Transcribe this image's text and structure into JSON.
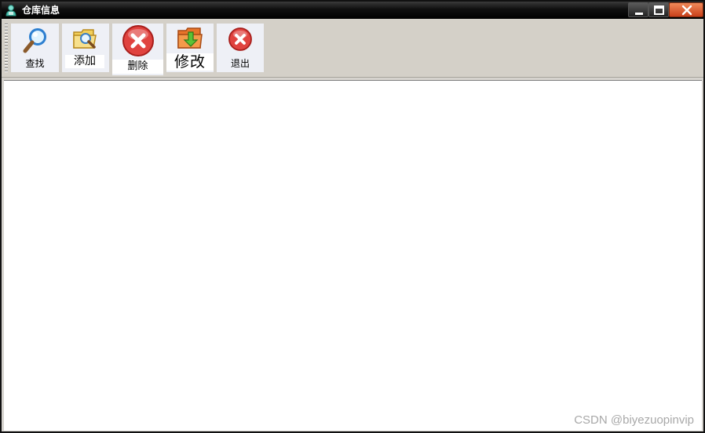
{
  "window": {
    "title": "仓库信息",
    "title_icon": "app-user-icon",
    "controls": {
      "minimize": "minimize-icon",
      "maximize": "maximize-icon",
      "close": "close-icon"
    }
  },
  "toolbar": {
    "buttons": [
      {
        "label": "查找",
        "icon": "magnifier-icon"
      },
      {
        "label": "添加",
        "icon": "folder-search-icon"
      },
      {
        "label": "删除",
        "icon": "red-x-circle-icon"
      },
      {
        "label": "修改",
        "icon": "folder-arrow-icon"
      },
      {
        "label": "退出",
        "icon": "red-x-circle-icon"
      }
    ]
  },
  "watermark": "CSDN @biyezuopinvip",
  "colors": {
    "titlebar": "#000000",
    "toolbar": "#d4d0c8",
    "button_face": "#eef0f6",
    "close_button": "#e0602f",
    "content": "#ffffff"
  }
}
